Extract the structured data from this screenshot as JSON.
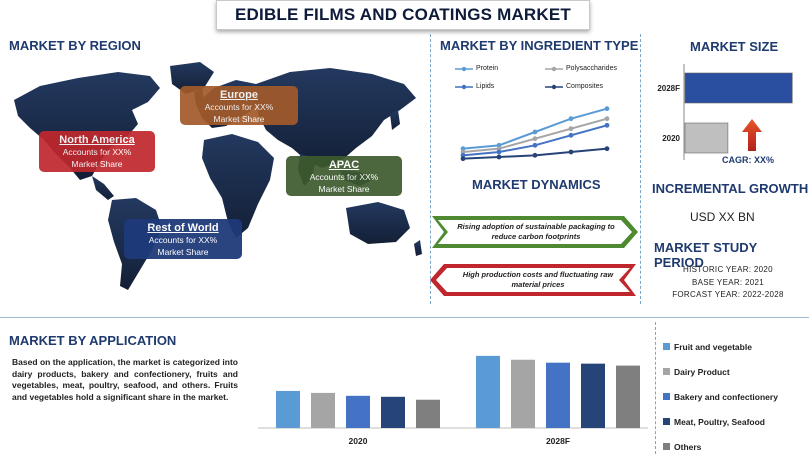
{
  "title": "EDIBLE FILMS AND COATINGS MARKET",
  "region": {
    "heading": "MARKET BY REGION",
    "boxes": [
      {
        "name": "Europe",
        "line1": "Accounts for XX%",
        "line2": "Market Share",
        "color": "#a25a2a"
      },
      {
        "name": "North America",
        "line1": "Accounts for XX%",
        "line2": "Market Share",
        "color": "#c0272d"
      },
      {
        "name": "APAC",
        "line1": "Accounts for XX%",
        "line2": "Market Share",
        "color": "#3d5a2e"
      },
      {
        "name": "Rest of World",
        "line1": "Accounts for XX%",
        "line2": "Market Share",
        "color": "#1f3a7a"
      }
    ]
  },
  "ingredient": {
    "heading": "MARKET BY INGREDIENT TYPE",
    "legend": [
      "Protein",
      "Polysaccharides",
      "Lipids",
      "Composites"
    ]
  },
  "dynamics": {
    "heading": "MARKET DYNAMICS",
    "driver": "Rising adoption of sustainable packaging to reduce carbon footprints",
    "restraint": "High production costs and fluctuating raw material prices",
    "driver_color": "#4e8a32",
    "restraint_color": "#c0272d"
  },
  "size": {
    "heading": "MARKET SIZE",
    "cagr": "CAGR: XX%"
  },
  "growth": {
    "heading": "INCREMENTAL GROWTH",
    "value": "USD XX BN"
  },
  "study": {
    "heading": "MARKET STUDY PERIOD",
    "historic": "HISTORIC YEAR: 2020",
    "base": "BASE YEAR: 2021",
    "forecast": "FORCAST YEAR: 2022-2028"
  },
  "application": {
    "heading": "MARKET BY APPLICATION",
    "text": "Based on the application, the market is categorized into dairy products, bakery and confectionery, fruits and vegetables, meat, poultry, seafood, and others. Fruits and vegetables hold a significant share in the market.",
    "legend": [
      "Fruit and vegetable",
      "Dairy Product",
      "Bakery and confectionery",
      "Meat, Poultry, Seafood",
      "Others"
    ]
  },
  "chart_data": [
    {
      "type": "line",
      "title": "MARKET BY INGREDIENT TYPE",
      "x": [
        1,
        2,
        3,
        4,
        5
      ],
      "series": [
        {
          "name": "Protein",
          "values": [
            4,
            5,
            9,
            13,
            16
          ],
          "color": "#5b9bd5"
        },
        {
          "name": "Polysaccharides",
          "values": [
            3,
            4,
            7,
            10,
            13
          ],
          "color": "#a5a5a5"
        },
        {
          "name": "Lipids",
          "values": [
            2,
            3,
            5,
            8,
            11
          ],
          "color": "#4472c4"
        },
        {
          "name": "Composites",
          "values": [
            1,
            1.5,
            2,
            3,
            4
          ],
          "color": "#264478"
        }
      ],
      "ylim": [
        0,
        18
      ]
    },
    {
      "type": "bar",
      "orientation": "horizontal",
      "title": "MARKET SIZE",
      "categories": [
        "2028F",
        "2020"
      ],
      "values": [
        100,
        40
      ],
      "colors": [
        "#2a4ea0",
        "#bfbfbf"
      ],
      "xlim": [
        0,
        110
      ]
    },
    {
      "type": "bar",
      "title": "MARKET BY APPLICATION",
      "categories": [
        "2020",
        "2028F"
      ],
      "series": [
        {
          "name": "Fruit and vegetable",
          "values": [
            38,
            74
          ],
          "color": "#5b9bd5"
        },
        {
          "name": "Dairy Product",
          "values": [
            36,
            70
          ],
          "color": "#a5a5a5"
        },
        {
          "name": "Bakery and confectionery",
          "values": [
            33,
            67
          ],
          "color": "#4472c4"
        },
        {
          "name": "Meat, Poultry, Seafood",
          "values": [
            32,
            66
          ],
          "color": "#264478"
        },
        {
          "name": "Others",
          "values": [
            29,
            64
          ],
          "color": "#7f7f7f"
        }
      ],
      "ylim": [
        0,
        80
      ]
    }
  ]
}
